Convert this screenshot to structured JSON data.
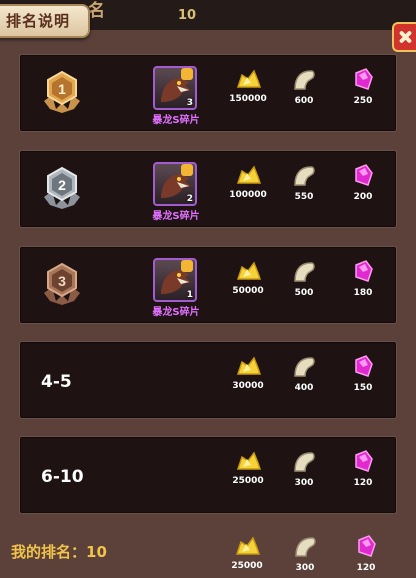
{
  "header": {
    "tab_title": "排名说明",
    "partial_title": "名",
    "partial_value": "10"
  },
  "piece_name": "暴龙S碎片",
  "rows": [
    {
      "rank": "1",
      "piece_count": "3",
      "gold": "150000",
      "tooth": "600",
      "gem": "250"
    },
    {
      "rank": "2",
      "piece_count": "2",
      "gold": "100000",
      "tooth": "550",
      "gem": "200"
    },
    {
      "rank": "3",
      "piece_count": "1",
      "gold": "50000",
      "tooth": "500",
      "gem": "180"
    },
    {
      "rank": "4-5",
      "gold": "30000",
      "tooth": "400",
      "gem": "150"
    },
    {
      "rank": "6-10",
      "gold": "25000",
      "tooth": "300",
      "gem": "120"
    }
  ],
  "my_rank": {
    "label": "我的排名：10",
    "gold": "25000",
    "tooth": "300",
    "gem": "120"
  },
  "colors": {
    "gold": "#f5d23a",
    "tooth": "#e6dcc0",
    "gem": "#e02ad0",
    "piece_label": "#e070ff"
  }
}
